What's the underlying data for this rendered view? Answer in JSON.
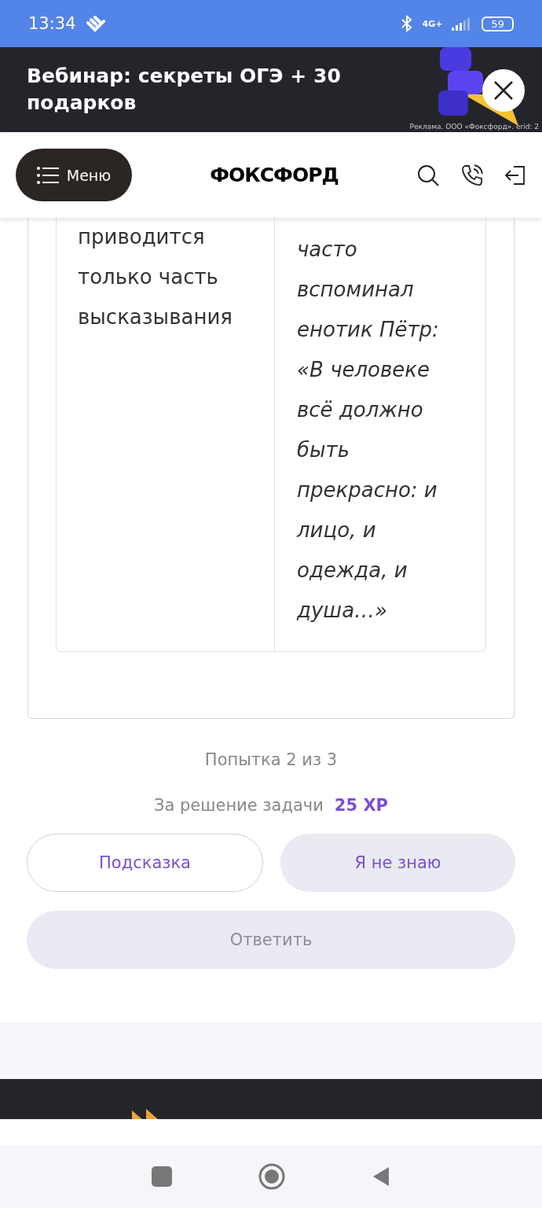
{
  "status_bar": {
    "time": "13:34",
    "battery": "59",
    "network": "4G+"
  },
  "ad_banner": {
    "title": "Вебинар: секреты ОГЭ + 30 подарков",
    "disclaimer": "Реклама. ООО «Фоксфорд». erid: 2"
  },
  "header": {
    "menu_label": "Меню",
    "logo": "ФОКСФОРД"
  },
  "table": {
    "left_lines": [
      "приводится",
      "только часть",
      "высказывания"
    ],
    "right_lines": [
      "часто",
      "вспоминал",
      "енотик Пётр:",
      "«В человеке",
      "всё должно",
      "быть",
      "прекрасно: и",
      "лицо, и",
      "одежда, и",
      "душа…»"
    ]
  },
  "attempt": "Попытка 2 из 3",
  "reward": {
    "label": "За решение задачи",
    "points": "25 XP"
  },
  "buttons": [
    {
      "label": "Подсказка",
      "kind": "outline",
      "disabled": false
    },
    {
      "label": "Я не знаю",
      "kind": "soft",
      "disabled": false
    },
    {
      "label": "Ответить",
      "kind": "wide",
      "disabled": true
    }
  ]
}
